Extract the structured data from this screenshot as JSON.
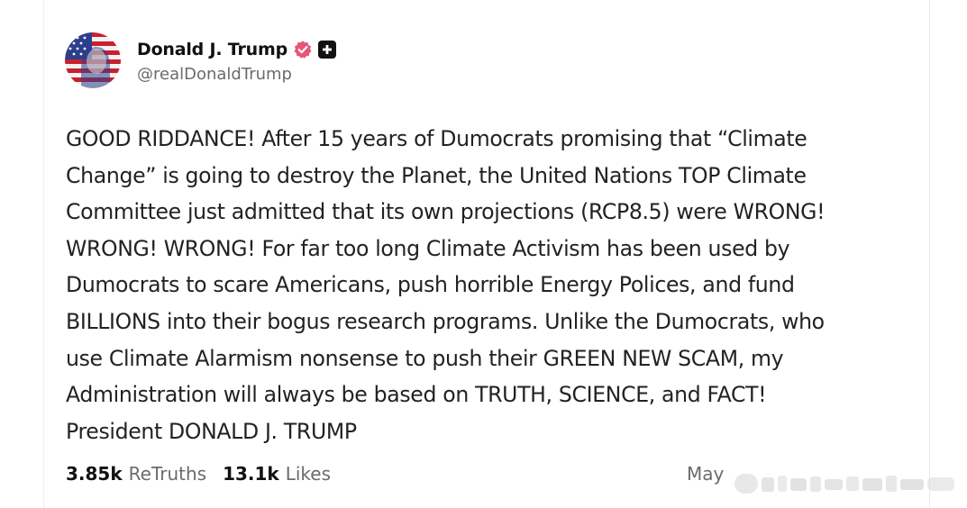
{
  "author": {
    "display_name": "Donald J. Trump",
    "handle": "@realDonaldTrump",
    "verified_icon": "verified-badge-icon",
    "plus_icon": "plus-square-icon",
    "accent_color": "#e8547a"
  },
  "post": {
    "text": "GOOD RIDDANCE! After 15 years of Dumocrats promising that “Climate\nChange” is going to destroy the Planet, the United Nations TOP Climate\nCommittee just admitted that its own projections (RCP8.5) were WRONG!\nWRONG! WRONG! For far too long Climate Activism has been used by\nDumocrats to scare Americans, push horrible Energy Polices, and fund\nBILLIONS into their bogus research programs. Unlike the Dumocrats, who\nuse Climate Alarmism nonsense to push their GREEN NEW SCAM, my\nAdministration will always be based on TRUTH, SCIENCE, and FACT!\nPresident DONALD J. TRUMP"
  },
  "stats": {
    "retruths_count": "3.85k",
    "retruths_label": "ReTruths",
    "likes_count": "13.1k",
    "likes_label": "Likes"
  },
  "date": {
    "text": "May"
  }
}
